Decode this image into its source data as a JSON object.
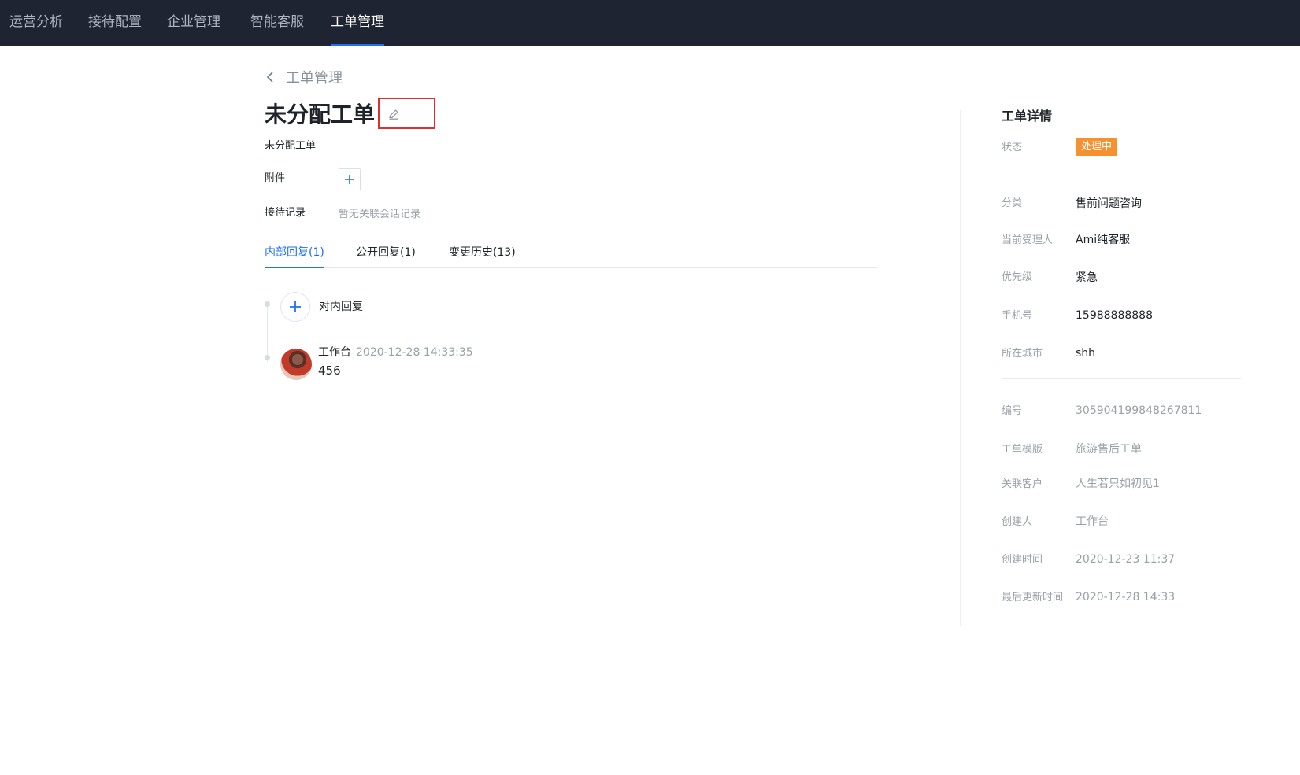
{
  "nav": {
    "items": [
      {
        "label": "运营分析"
      },
      {
        "label": "接待配置"
      },
      {
        "label": "企业管理"
      },
      {
        "label": "智能客服"
      },
      {
        "label": "工单管理"
      }
    ],
    "active": "工单管理"
  },
  "breadcrumb": {
    "back_label": "工单管理"
  },
  "ticket": {
    "title": "未分配工单",
    "description": "未分配工单",
    "attachment_label": "附件",
    "record_label": "接待记录",
    "record_empty": "暂无关联会话记录"
  },
  "tabs": [
    {
      "label": "内部回复(1)"
    },
    {
      "label": "公开回复(1)"
    },
    {
      "label": "变更历史(13)"
    }
  ],
  "reply": {
    "add_label": "对内回复",
    "author": "工作台",
    "time": "2020-12-28 14:33:35",
    "content": "456"
  },
  "detail": {
    "title": "工单详情",
    "status_label": "状态",
    "status_value": "处理中",
    "fields": [
      {
        "label": "分类",
        "value": "售前问题咨询"
      },
      {
        "label": "当前受理人",
        "value": "Ami纯客服"
      },
      {
        "label": "优先级",
        "value": "紧急"
      },
      {
        "label": "手机号",
        "value": "15988888888"
      },
      {
        "label": "所在城市",
        "value": "shh"
      }
    ],
    "meta": [
      {
        "label": "编号",
        "value": "305904199848267811"
      },
      {
        "label": "工单模版",
        "value": "旅游售后工单"
      },
      {
        "label": "关联客户",
        "value": "人生若只如初见1"
      },
      {
        "label": "创建人",
        "value": "工作台"
      },
      {
        "label": "创建时间",
        "value": "2020-12-23 11:37"
      },
      {
        "label": "最后更新时间",
        "value": "2020-12-28 14:33"
      }
    ]
  },
  "colors": {
    "nav_bg": "#1f2433",
    "accent": "#1e6ff5",
    "status_orange": "#f5922f",
    "highlight_red": "#e0302e"
  }
}
